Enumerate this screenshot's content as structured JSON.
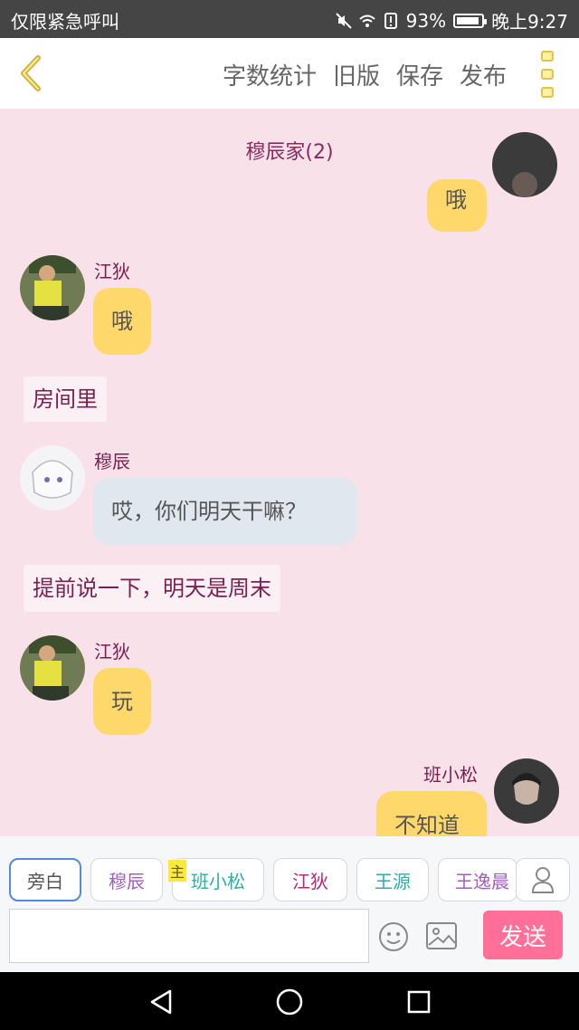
{
  "statusbar": {
    "left_text": "仅限紧急呼叫",
    "battery_pct": "93%",
    "time": "晚上9:27"
  },
  "topbar": {
    "actions": [
      "字数统计",
      "旧版",
      "保存",
      "发布"
    ]
  },
  "chat": {
    "group_title": "穆辰家(2)",
    "messages": [
      {
        "type": "right",
        "text": "哦"
      },
      {
        "type": "left",
        "name": "江狄",
        "text": "哦"
      },
      {
        "type": "narration",
        "text": "房间里"
      },
      {
        "type": "left",
        "name": "穆辰",
        "text": "哎，你们明天干嘛？"
      },
      {
        "type": "narration",
        "text": "提前说一下，明天是周末"
      },
      {
        "type": "left",
        "name": "江狄",
        "text": "玩"
      },
      {
        "type": "right",
        "name": "班小松",
        "text": "不知道"
      }
    ]
  },
  "characters": {
    "narrator": "旁白",
    "main_tag": "主",
    "items": [
      "穆辰",
      "班小松",
      "江狄",
      "王源",
      "王逸晨"
    ]
  },
  "input": {
    "send_label": "发送"
  },
  "colors": {
    "chat_bg": "#f9e1ea",
    "send_button": "#ff6f98",
    "name_text": "#7a1f50"
  }
}
